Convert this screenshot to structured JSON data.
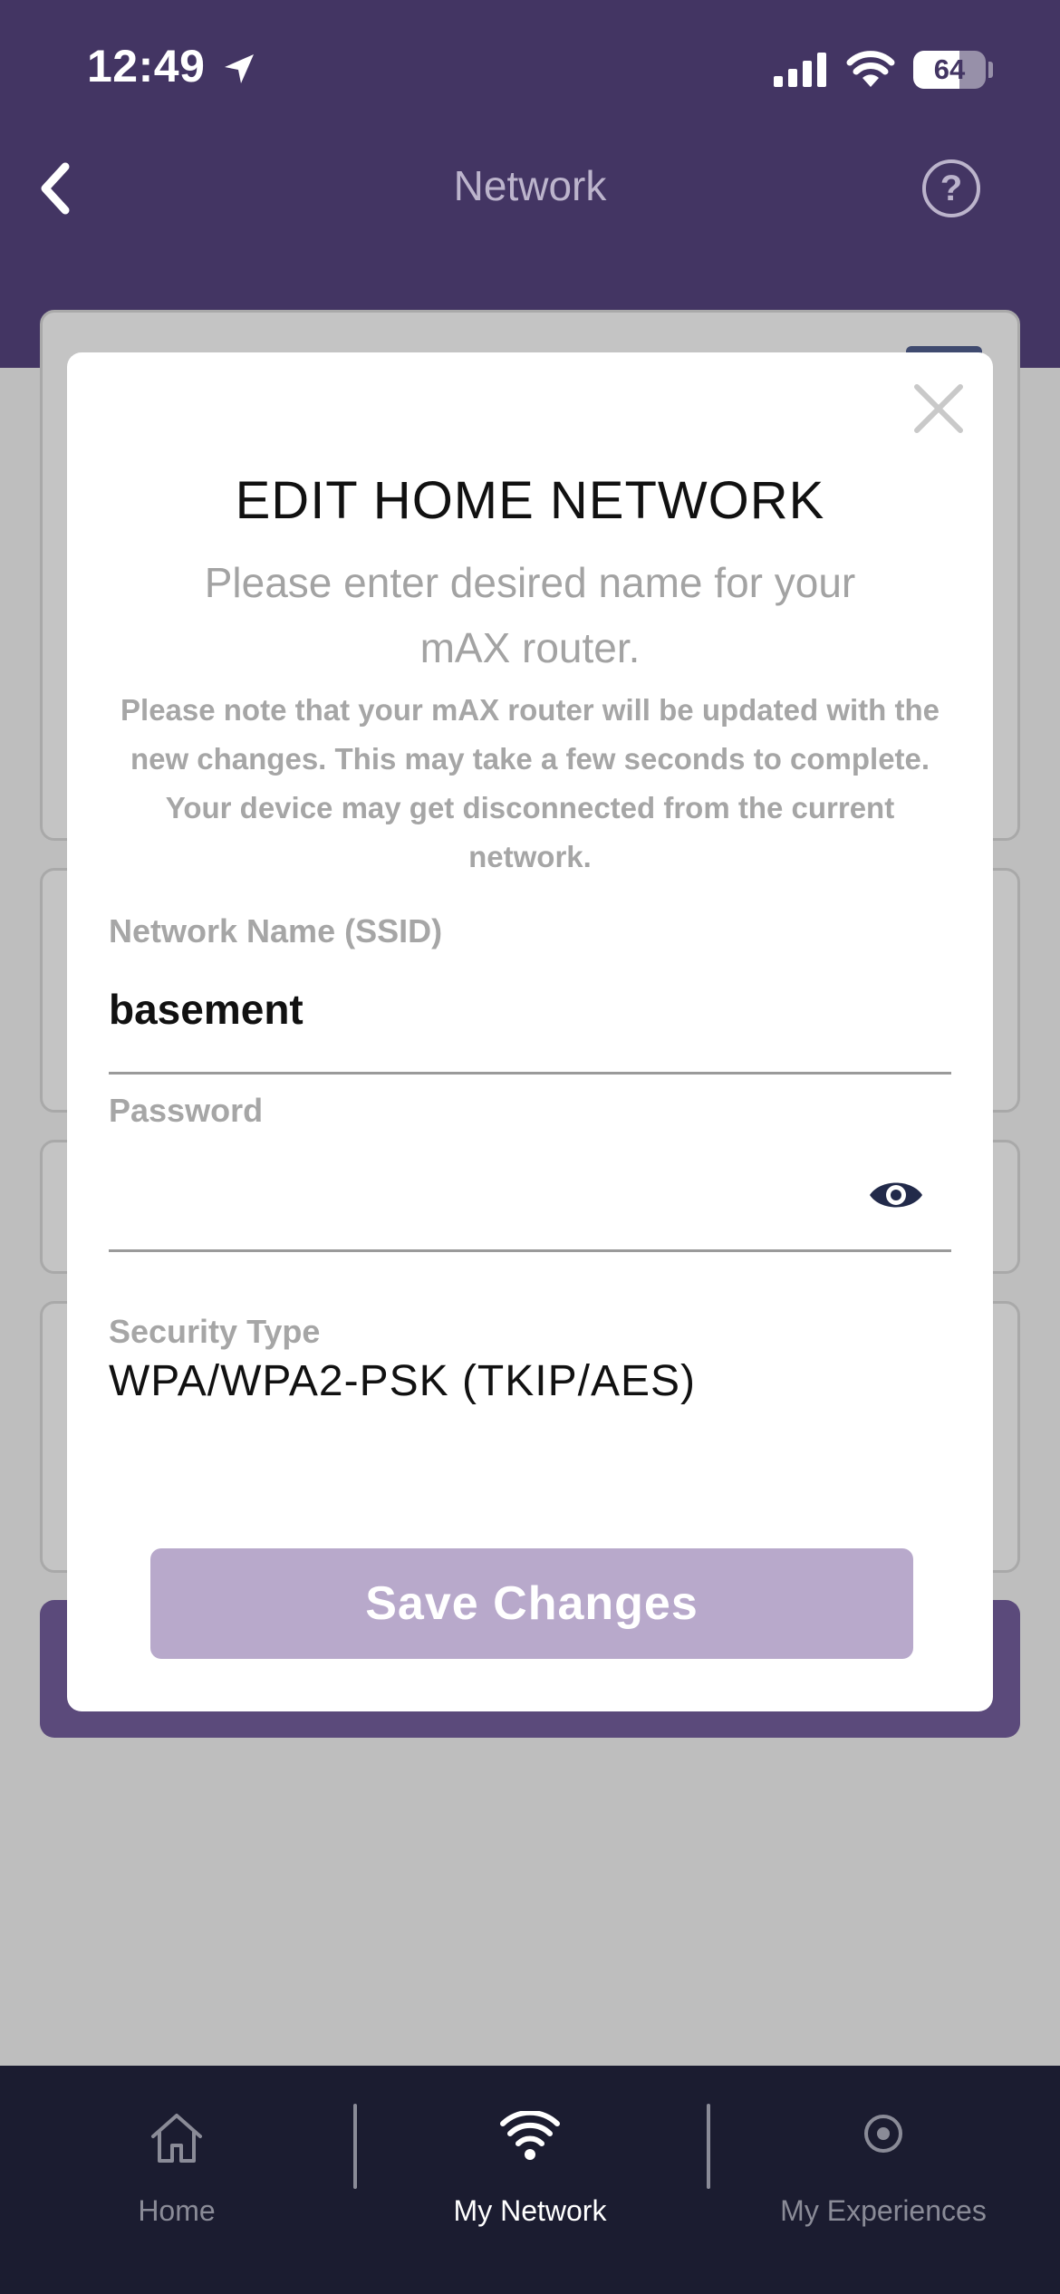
{
  "status_bar": {
    "time": "12:49",
    "battery": "64",
    "battery_level_percent": 64,
    "icons": [
      "location-arrow-icon",
      "cellular-signal-icon",
      "wifi-icon",
      "battery-icon"
    ]
  },
  "nav": {
    "title": "Network",
    "back_icon": "chevron-left-icon",
    "help_label": "?"
  },
  "modal": {
    "title": "EDIT HOME NETWORK",
    "subtitle": "Please enter desired name for your mAX router.",
    "note": "Please note that your mAX router will be updated with the new changes. This may take a few seconds to complete. Your device may get disconnected from the current network.",
    "ssid_label": "Network Name (SSID)",
    "ssid_value": "basement",
    "password_label": "Password",
    "password_value": "",
    "security_label": "Security Type",
    "security_value": "WPA/WPA2-PSK (TKIP/AES)",
    "save_label": "Save Changes"
  },
  "tabbar": {
    "items": [
      {
        "label": "Home",
        "icon": "home-icon",
        "active": false
      },
      {
        "label": "My Network",
        "icon": "wifi-icon",
        "active": true
      },
      {
        "label": "My Experiences",
        "icon": "target-icon",
        "active": false
      }
    ]
  },
  "colors": {
    "header": "#433563",
    "overlay": "#bebebe",
    "save_button": "#b8a9cb",
    "tabbar": "#1b1c30",
    "eye_icon": "#222a4a"
  }
}
